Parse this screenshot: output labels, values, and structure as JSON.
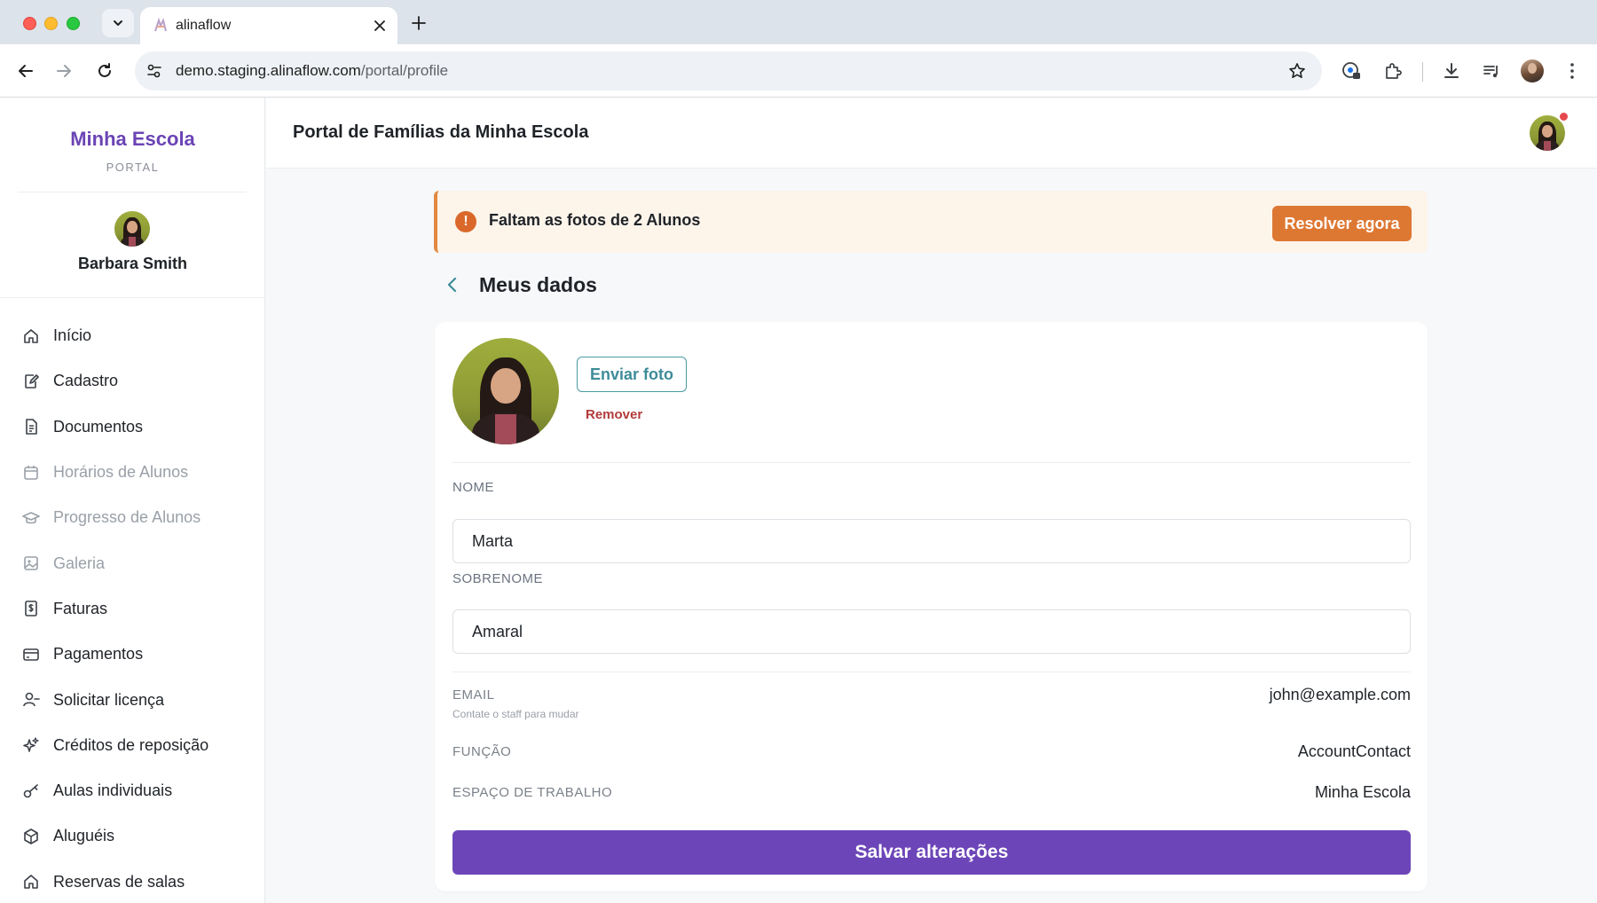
{
  "browser": {
    "tab_title": "alinaflow",
    "url_host": "demo.staging.alinaflow.com",
    "url_path": "/portal/profile"
  },
  "sidebar": {
    "brand": "Minha Escola",
    "brand_sub": "PORTAL",
    "user_name": "Barbara Smith",
    "items": [
      {
        "label": "Início",
        "icon": "home-icon",
        "disabled": false
      },
      {
        "label": "Cadastro",
        "icon": "edit-document-icon",
        "disabled": false
      },
      {
        "label": "Documentos",
        "icon": "document-icon",
        "disabled": false
      },
      {
        "label": "Horários de Alunos",
        "icon": "calendar-icon",
        "disabled": true
      },
      {
        "label": "Progresso de Alunos",
        "icon": "graduation-cap-icon",
        "disabled": true
      },
      {
        "label": "Galeria",
        "icon": "image-icon",
        "disabled": true
      },
      {
        "label": "Faturas",
        "icon": "invoice-icon",
        "disabled": false
      },
      {
        "label": "Pagamentos",
        "icon": "credit-card-icon",
        "disabled": false
      },
      {
        "label": "Solicitar licença",
        "icon": "user-minus-icon",
        "disabled": false
      },
      {
        "label": "Créditos de reposição",
        "icon": "sparkles-icon",
        "disabled": false
      },
      {
        "label": "Aulas individuais",
        "icon": "key-icon",
        "disabled": false
      },
      {
        "label": "Aluguéis",
        "icon": "package-icon",
        "disabled": false
      },
      {
        "label": "Reservas de salas",
        "icon": "home-icon",
        "disabled": false
      }
    ]
  },
  "header": {
    "title": "Portal de Famílias da Minha Escola"
  },
  "alert": {
    "message": "Faltam as fotos de 2 Alunos",
    "action_label": "Resolver agora",
    "icon": "exclamation-icon"
  },
  "profile": {
    "section_title": "Meus dados",
    "upload_label": "Enviar foto",
    "remove_label": "Remover",
    "first_name_label": "NOME",
    "first_name_value": "Marta",
    "last_name_label": "SOBRENOME",
    "last_name_value": "Amaral",
    "email_label": "EMAIL",
    "email_hint": "Contate o staff para mudar",
    "email_value": "john@example.com",
    "role_label": "FUNÇÃO",
    "role_value": "AccountContact",
    "workspace_label": "ESPAÇO DE TRABALHO",
    "workspace_value": "Minha Escola",
    "save_label": "Salvar alterações"
  },
  "colors": {
    "brand": "#6b44b5",
    "primary_button": "#6c46b8",
    "alert_accent": "#dd7833",
    "upload_accent": "#3e8c98",
    "danger": "#b23a3a"
  }
}
